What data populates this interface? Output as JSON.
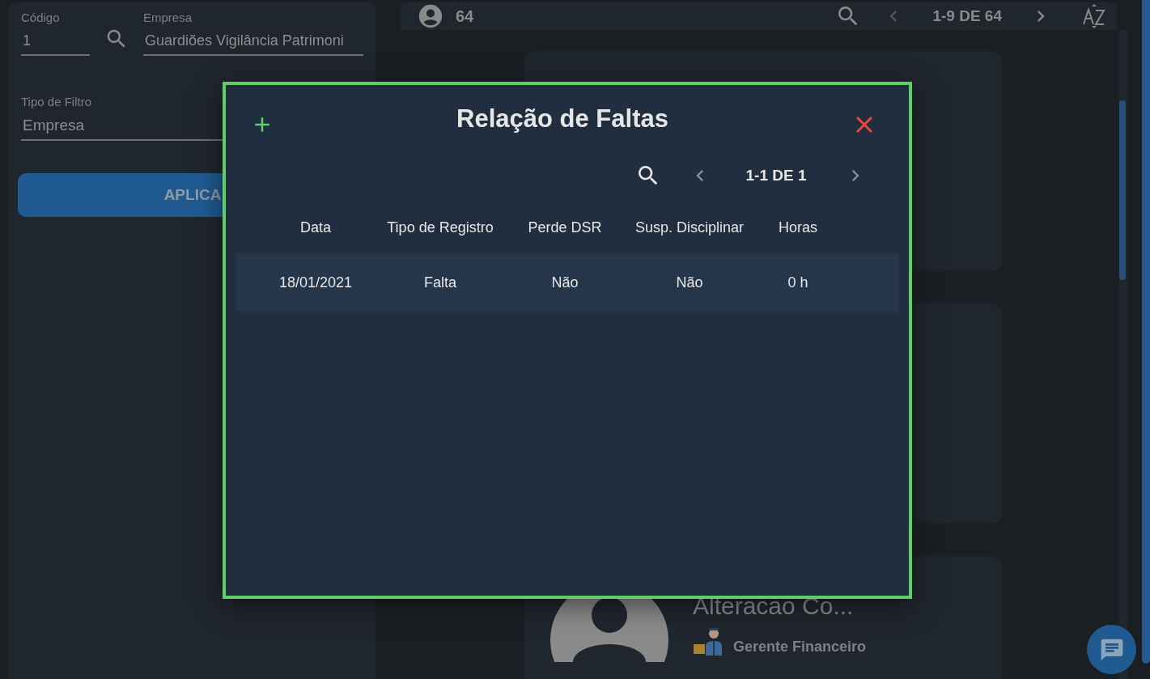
{
  "filters": {
    "codigo": {
      "label": "Código",
      "value": "1"
    },
    "empresa": {
      "label": "Empresa",
      "value": "Guardiões Vigilância Patrimoni"
    },
    "tipo_filtro": {
      "label": "Tipo de Filtro",
      "value": "Empresa"
    },
    "apply_button": "APLICA"
  },
  "toolbar": {
    "count": "64",
    "pagination": "1-9 DE 64"
  },
  "visible_card": {
    "name": "Alteracao Co...",
    "role": "Gerente Financeiro"
  },
  "modal": {
    "title": "Relação de Faltas",
    "pagination": "1-1 DE 1",
    "table": {
      "columns": [
        "Data",
        "Tipo de Registro",
        "Perde DSR",
        "Susp. Disciplinar",
        "Horas"
      ],
      "rows": [
        [
          "18/01/2021",
          "Falta",
          "Não",
          "Não",
          "0 h"
        ]
      ]
    }
  }
}
